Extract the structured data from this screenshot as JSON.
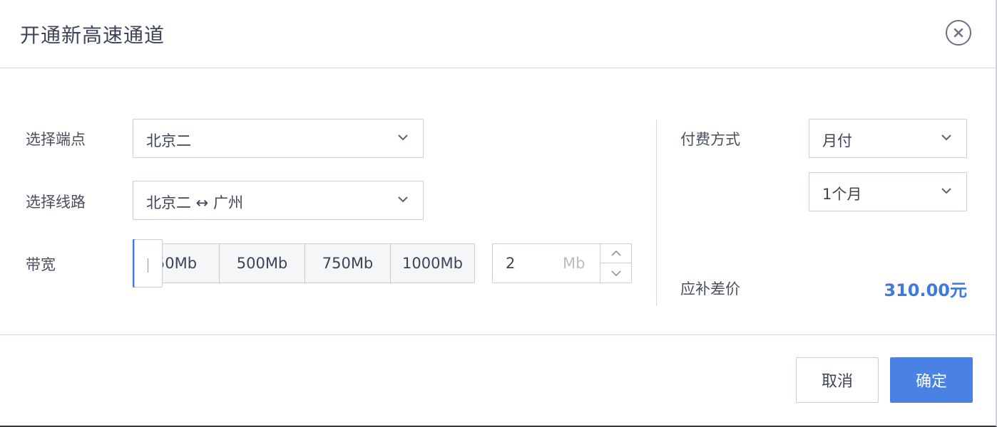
{
  "dialog": {
    "title": "开通新高速通道"
  },
  "form": {
    "endpoint": {
      "label": "选择端点",
      "value": "北京二"
    },
    "route": {
      "label": "选择线路",
      "value": "北京二 ↔ 广州"
    },
    "bandwidth": {
      "label": "带宽",
      "options": [
        "50Mb",
        "500Mb",
        "750Mb",
        "1000Mb"
      ],
      "input_value": "2",
      "unit": "Mb"
    }
  },
  "billing": {
    "payment_label": "付费方式",
    "payment_value": "月付",
    "duration_value": "1个月",
    "diff_label": "应补差价",
    "diff_amount": "310.00元"
  },
  "footer": {
    "cancel_label": "取消",
    "ok_label": "确定"
  },
  "colors": {
    "accent": "#4a82e3",
    "price": "#3e78e0",
    "border": "#c8ccd5"
  }
}
